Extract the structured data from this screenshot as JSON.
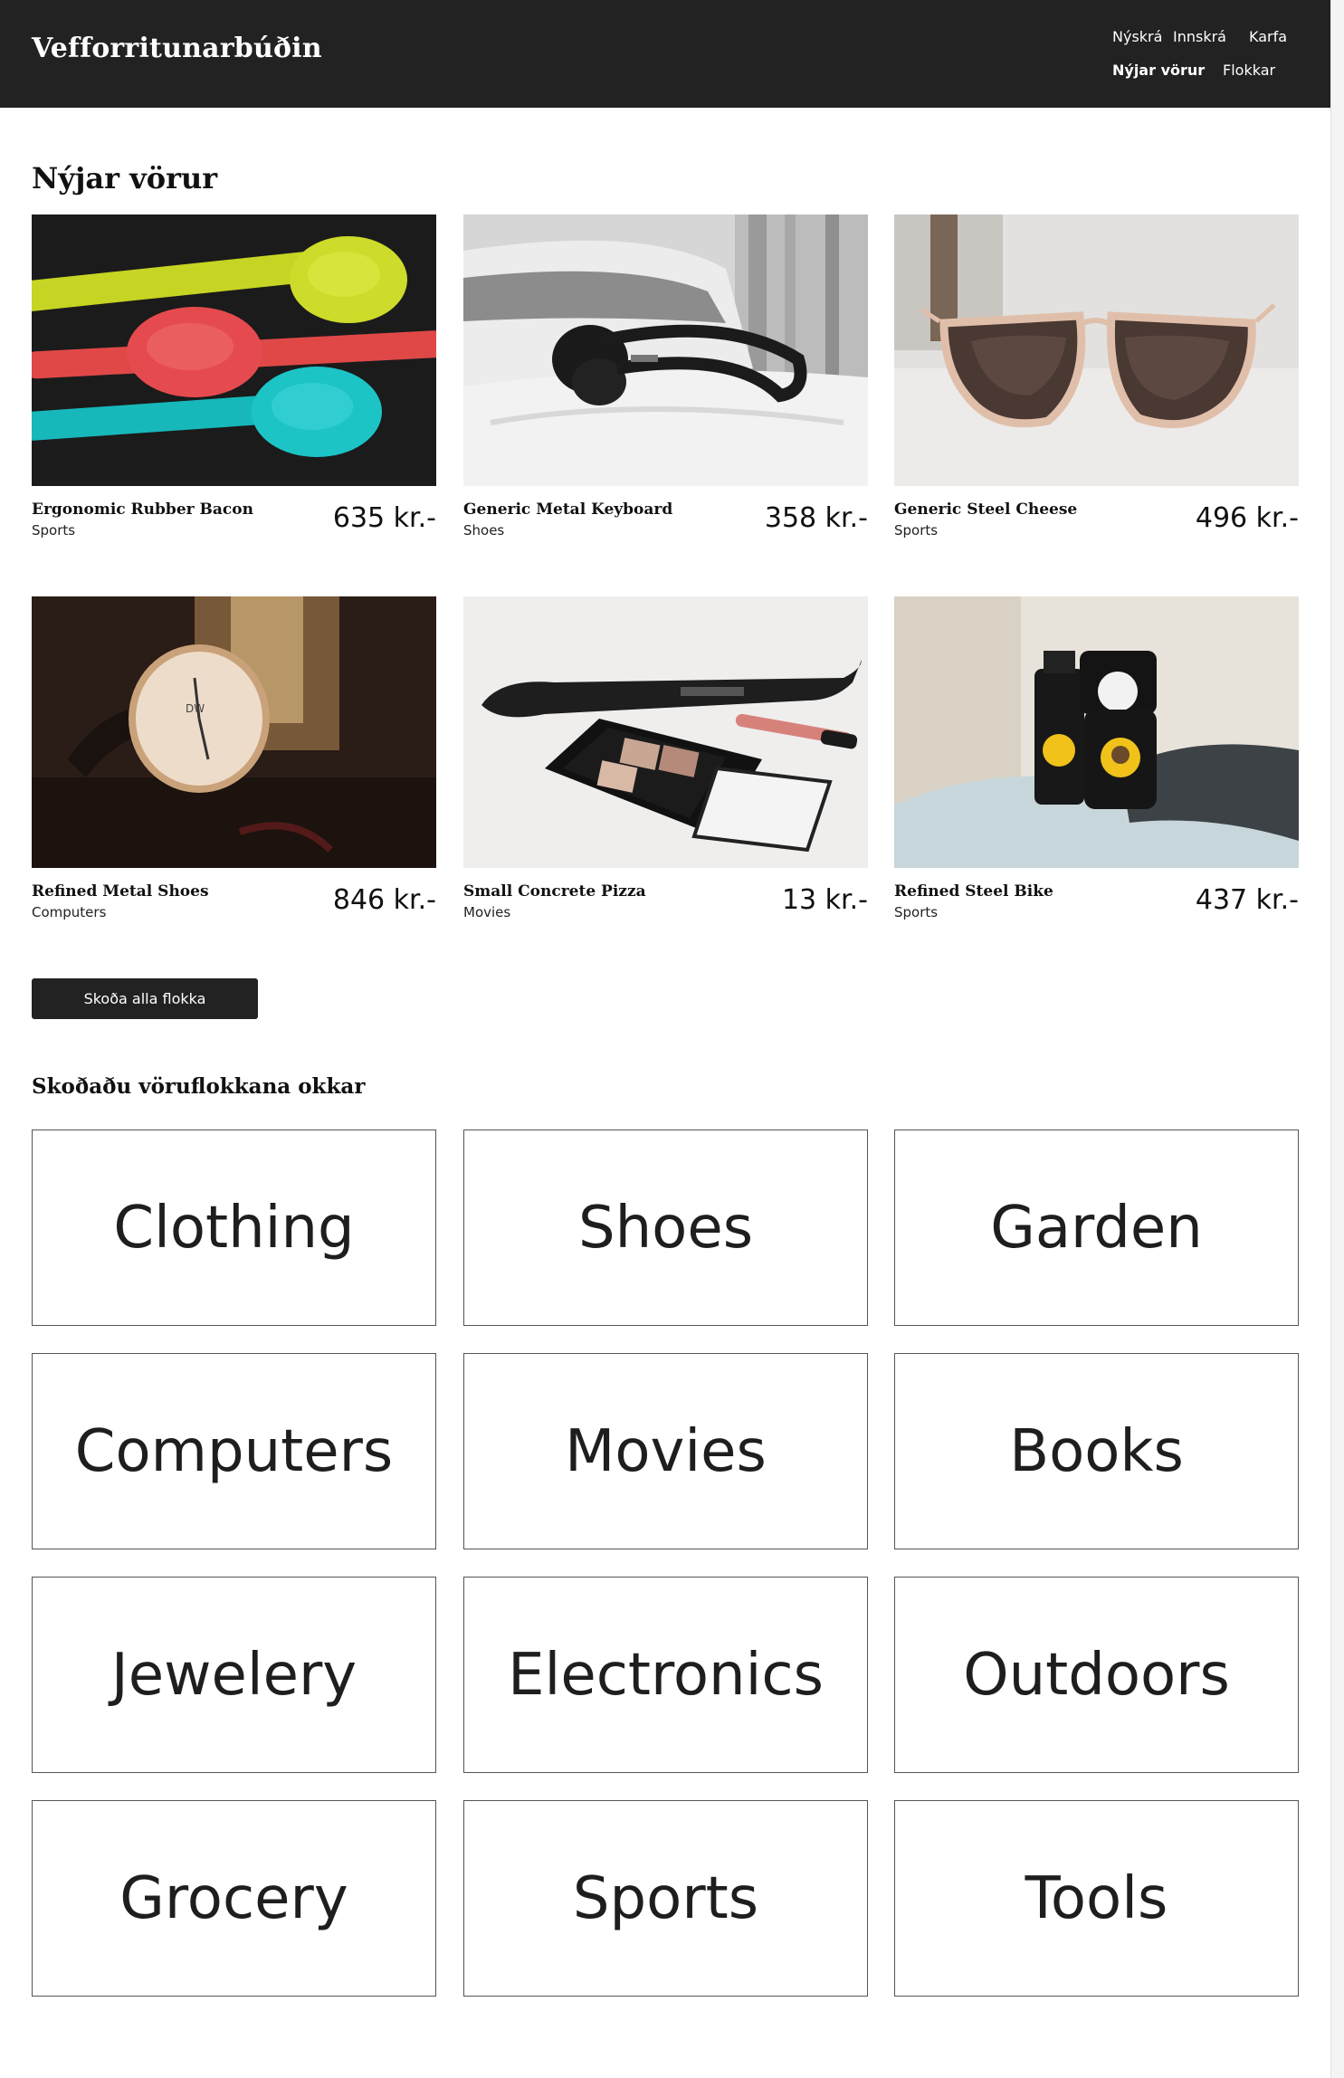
{
  "header": {
    "site_title": "Vefforritunarbúðin",
    "nav": {
      "signup": "Nýskrá",
      "login": "Innskrá",
      "cart": "Karfa",
      "new_products": "Nýjar vörur",
      "categories": "Flokkar"
    }
  },
  "new_products": {
    "heading": "Nýjar vörur",
    "items": [
      {
        "name": "Ergonomic Rubber Bacon",
        "category": "Sports",
        "price": "635 kr.-",
        "image": "colorful-spoons"
      },
      {
        "name": "Generic Metal Keyboard",
        "category": "Shoes",
        "price": "358 kr.-",
        "image": "headphones-on-pillow"
      },
      {
        "name": "Generic Steel Cheese",
        "category": "Sports",
        "price": "496 kr.-",
        "image": "sunglasses"
      },
      {
        "name": "Refined Metal Shoes",
        "category": "Computers",
        "price": "846 kr.-",
        "image": "wristwatch"
      },
      {
        "name": "Small Concrete Pizza",
        "category": "Movies",
        "price": "13 kr.-",
        "image": "hair-straightener-and-makeup"
      },
      {
        "name": "Refined Steel Bike",
        "category": "Sports",
        "price": "437 kr.-",
        "image": "cosmetic-bottles-on-towel"
      }
    ],
    "view_all_button": "Skoða alla flokka"
  },
  "categories": {
    "heading": "Skoðaðu vöruflokkana okkar",
    "items": [
      "Clothing",
      "Shoes",
      "Garden",
      "Computers",
      "Movies",
      "Books",
      "Jewelery",
      "Electronics",
      "Outdoors",
      "Grocery",
      "Sports",
      "Tools"
    ]
  },
  "colors": {
    "header_bg": "#222222",
    "text": "#1e1e1e",
    "button_bg": "#222222",
    "tile_border": "#555555"
  }
}
